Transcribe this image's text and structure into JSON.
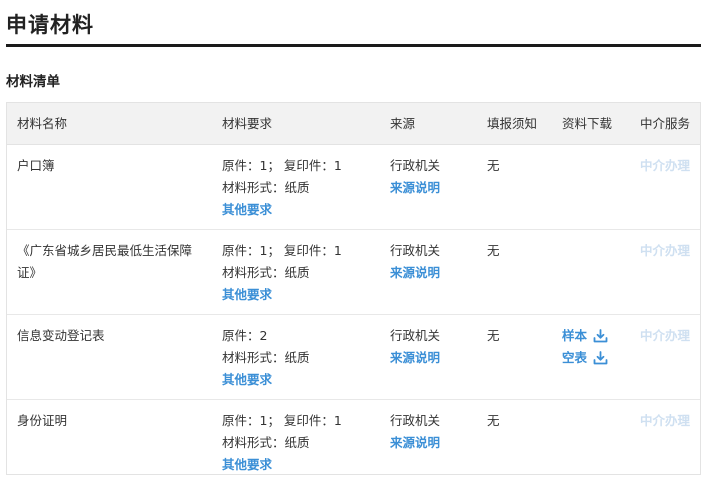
{
  "page": {
    "title": "申请材料"
  },
  "section": {
    "title": "材料清单"
  },
  "table": {
    "headers": {
      "name": "材料名称",
      "requirement": "材料要求",
      "source": "来源",
      "fill": "填报须知",
      "download": "资料下载",
      "agent": "中介服务"
    },
    "rows": [
      {
        "name": "户口簿",
        "req_line1": "原件：1； 复印件：1",
        "req_line2": "材料形式：纸质",
        "req_link": "其他要求",
        "source": "行政机关",
        "source_link": "来源说明",
        "fill": "无",
        "agent": "中介办理"
      },
      {
        "name": "《广东省城乡居民最低生活保障证》",
        "req_line1": "原件：1； 复印件：1",
        "req_line2": "材料形式：纸质",
        "req_link": "其他要求",
        "source": "行政机关",
        "source_link": "来源说明",
        "fill": "无",
        "agent": "中介办理"
      },
      {
        "name": "信息变动登记表",
        "req_line1": "原件：2",
        "req_line2": "材料形式：纸质",
        "req_link": "其他要求",
        "source": "行政机关",
        "source_link": "来源说明",
        "fill": "无",
        "download_sample": "样本",
        "download_blank": "空表",
        "agent": "中介办理"
      },
      {
        "name": "身份证明",
        "req_line1": "原件：1； 复印件：1",
        "req_line2": "材料形式：纸质",
        "req_link": "其他要求",
        "source": "行政机关",
        "source_link": "来源说明",
        "fill": "无",
        "agent": "中介办理"
      }
    ]
  },
  "icons": {
    "download": "download-icon"
  },
  "colors": {
    "link": "#3b8fd6",
    "agent_disabled": "#cfe0f1",
    "header_bg": "#f2f2f2",
    "title_rule": "#1a1a1a"
  }
}
